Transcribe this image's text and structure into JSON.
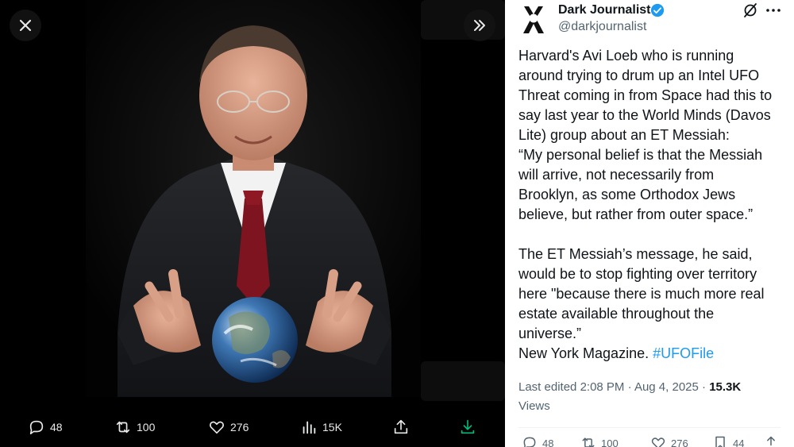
{
  "viewer": {
    "close_icon": "close-icon",
    "next_icon": "chevrons-right-icon",
    "actions": {
      "replies": "48",
      "reposts": "100",
      "likes": "276",
      "views": "15K"
    }
  },
  "tweet": {
    "author": {
      "name": "Dark Journalist",
      "handle": "@darkjournalist",
      "verified": true,
      "avatar_text": "DJ"
    },
    "text_lines": [
      "Harvard's Avi Loeb who is running",
      "around trying to drum up an Intel UFO",
      "Threat coming in from Space had this to",
      "say last year to the World Minds (Davos",
      "Lite) group about an ET Messiah:",
      "“My personal belief is that the Messiah",
      "will arrive, not necessarily from",
      "Brooklyn, as some Orthodox Jews",
      "believe, but rather from outer space.”",
      "",
      "The ET Messiah’s message, he said,",
      "would be to stop fighting over territory",
      "here \"because there is much more real",
      "estate available throughout the",
      "universe.”"
    ],
    "last_line_prefix": "New York Magazine.",
    "hashtag": "#UFOFile",
    "edited_label": "Last edited",
    "time": "2:08 PM",
    "separator": "·",
    "date": "Aug 4, 2025",
    "views_count": "15.3K",
    "views_label": "Views",
    "actions": {
      "replies": "48",
      "reposts": "100",
      "likes": "276",
      "bookmarks": "44"
    }
  },
  "colors": {
    "accent": "#1d9bf0",
    "text_primary": "#0f1419",
    "text_secondary": "#536471",
    "verified": "#1d9bf0"
  }
}
